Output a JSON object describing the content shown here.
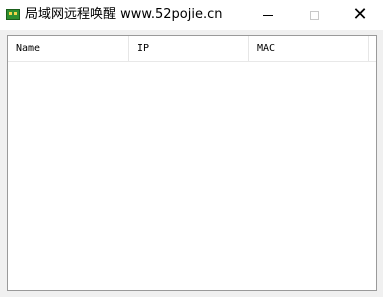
{
  "window": {
    "title": "局域网远程唤醒  www.52pojie.cn",
    "icon": "network-card-icon"
  },
  "controls": {
    "minimize_icon": "minimize-icon",
    "maximize_icon": "maximize-icon",
    "close_icon": "close-icon",
    "close_glyph": "✕"
  },
  "table": {
    "columns": [
      "Name",
      "IP",
      "MAC"
    ],
    "rows": []
  }
}
